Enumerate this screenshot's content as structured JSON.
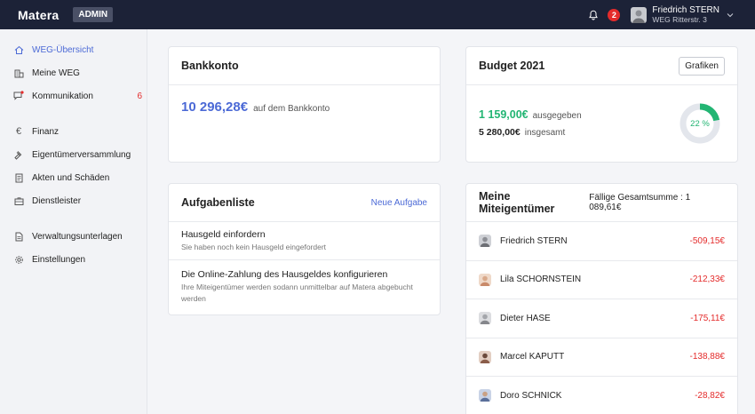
{
  "topbar": {
    "brand": "Matera",
    "badge": "ADMIN",
    "notification_count": "2",
    "user_name": "Friedrich STERN",
    "user_sub": "WEG Ritterstr. 3"
  },
  "sidebar": {
    "items": [
      {
        "label": "WEG-Übersicht",
        "icon": "home-icon"
      },
      {
        "label": "Meine WEG",
        "icon": "building-icon"
      },
      {
        "label": "Kommunikation",
        "icon": "chat-icon",
        "count": "6"
      },
      {
        "label": "Finanz",
        "icon": "euro-icon"
      },
      {
        "label": "Eigentümerversammlung",
        "icon": "gavel-icon"
      },
      {
        "label": "Akten und Schäden",
        "icon": "document-icon"
      },
      {
        "label": "Dienstleister",
        "icon": "briefcase-icon"
      },
      {
        "label": "Verwaltungsunterlagen",
        "icon": "file-icon"
      },
      {
        "label": "Einstellungen",
        "icon": "gear-icon"
      }
    ]
  },
  "bank": {
    "title": "Bankkonto",
    "amount": "10 296,28€",
    "suffix": "auf dem Bankkonto"
  },
  "budget": {
    "title": "Budget 2021",
    "button": "Grafiken",
    "spent": "1 159,00€",
    "spent_label": "ausgegeben",
    "total": "5 280,00€",
    "total_label": "insgesamt",
    "percent_label": "22 %",
    "percent_value": 22,
    "accent": "#22b573"
  },
  "tasks": {
    "title": "Aufgabenliste",
    "link": "Neue Aufgabe",
    "items": [
      {
        "title": "Hausgeld einfordern",
        "sub": "Sie haben noch kein Hausgeld eingefordert"
      },
      {
        "title": "Die Online-Zahlung des Hausgeldes konfigurieren",
        "sub": "Ihre Miteigentümer werden sodann unmittelbar auf Matera abgebucht werden"
      }
    ]
  },
  "owners": {
    "title": "Meine Miteigentümer",
    "summary": "Fällige Gesamtsumme : 1 089,61€",
    "rows": [
      {
        "name": "Friedrich STERN",
        "amount": "-509,15€"
      },
      {
        "name": "Lila SCHORNSTEIN",
        "amount": "-212,33€"
      },
      {
        "name": "Dieter HASE",
        "amount": "-175,11€"
      },
      {
        "name": "Marcel KAPUTT",
        "amount": "-138,88€"
      },
      {
        "name": "Doro SCHNICK",
        "amount": "-28,82€"
      }
    ]
  }
}
